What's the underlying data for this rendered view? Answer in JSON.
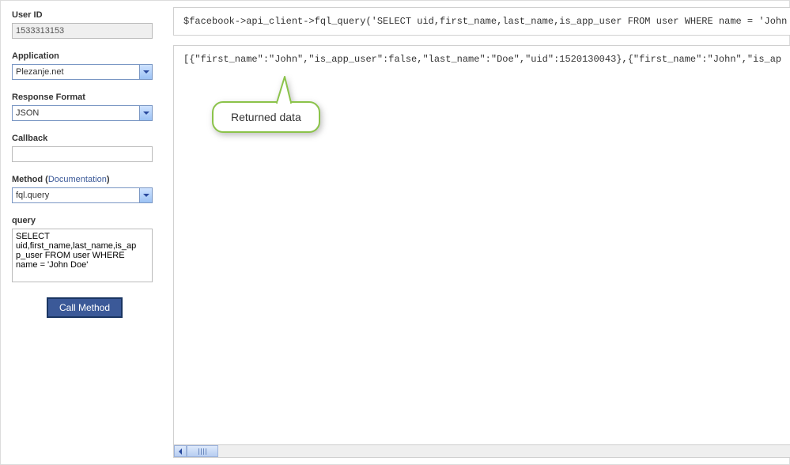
{
  "sidebar": {
    "userId": {
      "label": "User ID",
      "value": "1533313153"
    },
    "application": {
      "label": "Application",
      "value": "Plezanje.net"
    },
    "responseFormat": {
      "label": "Response Format",
      "value": "JSON"
    },
    "callback": {
      "label": "Callback",
      "value": ""
    },
    "method": {
      "label": "Method (",
      "docLink": "Documentation",
      "labelClose": ")",
      "value": "fql.query"
    },
    "query": {
      "label": "query",
      "value": "SELECT uid,first_name,last_name,is_app_user FROM user WHERE name = 'John Doe'"
    },
    "callButton": "Call Method"
  },
  "main": {
    "codeSnippet": "$facebook->api_client->fql_query('SELECT uid,first_name,last_name,is_app_user FROM user WHERE name = 'John Doe'');",
    "resultText": "[{\"first_name\":\"John\",\"is_app_user\":false,\"last_name\":\"Doe\",\"uid\":1520130043},{\"first_name\":\"John\",\"is_ap",
    "callout": "Returned data"
  }
}
